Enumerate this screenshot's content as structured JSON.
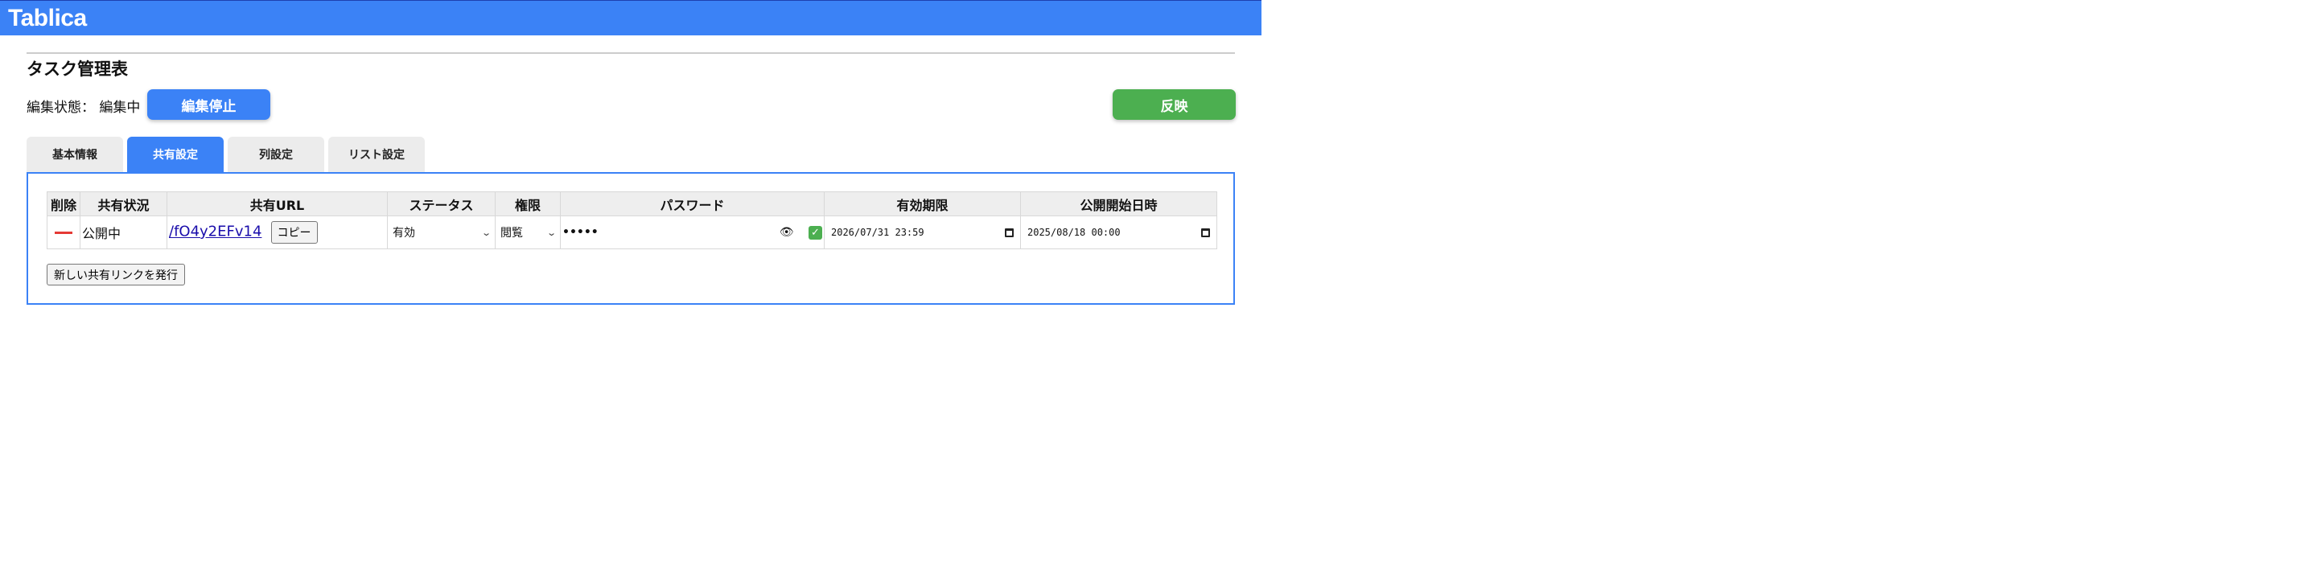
{
  "app": {
    "brand": "Tablica"
  },
  "page": {
    "title": "タスク管理表",
    "edit_state_label": "編集状態：",
    "edit_state_value": "編集中",
    "stop_button": "編集停止",
    "apply_button": "反映"
  },
  "colors": {
    "accent": "#3b82f6",
    "apply": "#4caf50",
    "delete": "#e53935"
  },
  "tabs": [
    {
      "label": "基本情報",
      "active": false
    },
    {
      "label": "共有設定",
      "active": true
    },
    {
      "label": "列設定",
      "active": false
    },
    {
      "label": "リスト設定",
      "active": false
    }
  ],
  "share_table": {
    "headers": [
      "削除",
      "共有状況",
      "共有URL",
      "ステータス",
      "権限",
      "パスワード",
      "有効期限",
      "公開開始日時"
    ],
    "rows": [
      {
        "delete_icon": "minus-icon",
        "status_text": "公開中",
        "url": "/fO4y2EFv14",
        "copy_label": "コピー",
        "status_select": "有効",
        "permission_select": "閲覧",
        "password_masked": "•••••",
        "show_password_icon": "eye-icon",
        "confirm_icon": "check-icon",
        "expires": "2026/07/31 23:59",
        "publish_start": "2025/08/18 00:00"
      }
    ]
  },
  "new_link_button": "新しい共有リンクを発行"
}
